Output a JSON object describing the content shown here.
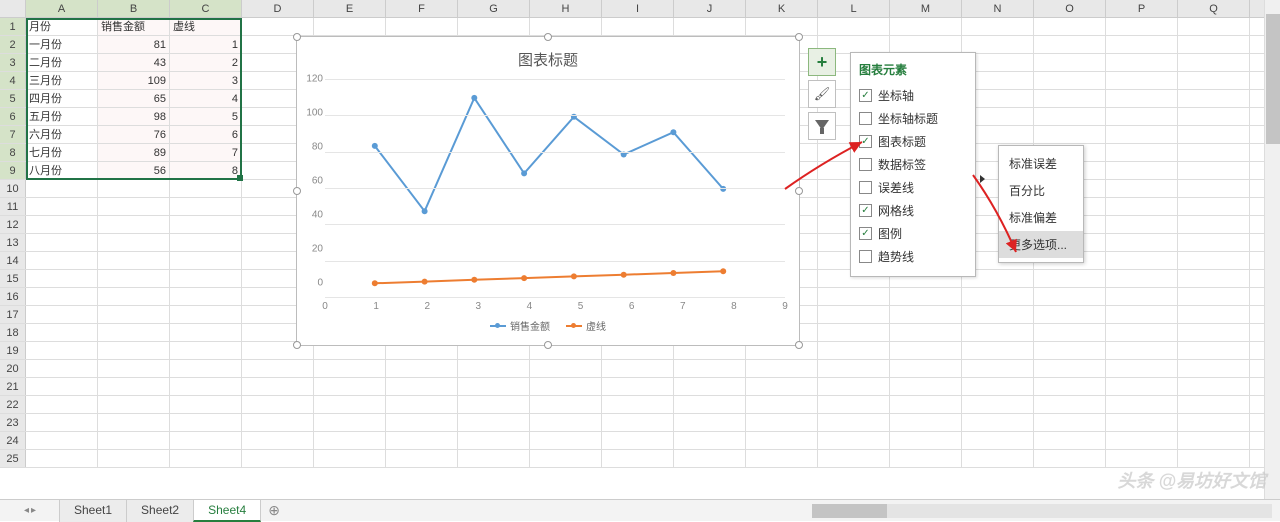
{
  "columns": [
    "A",
    "B",
    "C",
    "D",
    "E",
    "F",
    "G",
    "H",
    "I",
    "J",
    "K",
    "L",
    "M",
    "N",
    "O",
    "P",
    "Q"
  ],
  "rows": 25,
  "headers": {
    "A1": "月份",
    "B1": "销售金额",
    "C1": "虚线"
  },
  "table": [
    {
      "month": "一月份",
      "sales": 81,
      "dash": 1
    },
    {
      "month": "二月份",
      "sales": 43,
      "dash": 2
    },
    {
      "month": "三月份",
      "sales": 109,
      "dash": 3
    },
    {
      "month": "四月份",
      "sales": 65,
      "dash": 4
    },
    {
      "month": "五月份",
      "sales": 98,
      "dash": 5
    },
    {
      "month": "六月份",
      "sales": 76,
      "dash": 6
    },
    {
      "month": "七月份",
      "sales": 89,
      "dash": 7
    },
    {
      "month": "八月份",
      "sales": 56,
      "dash": 8
    }
  ],
  "chart_data": {
    "type": "line",
    "title": "图表标题",
    "x": [
      1,
      2,
      3,
      4,
      5,
      6,
      7,
      8
    ],
    "x_ticks": [
      0,
      1,
      2,
      3,
      4,
      5,
      6,
      7,
      8,
      9
    ],
    "y_ticks": [
      0,
      20,
      40,
      60,
      80,
      100,
      120
    ],
    "ylim": [
      0,
      120
    ],
    "xlim": [
      0,
      9
    ],
    "series": [
      {
        "name": "销售金额",
        "values": [
          81,
          43,
          109,
          65,
          98,
          76,
          89,
          56
        ],
        "color": "#5a9bd5"
      },
      {
        "name": "虚线",
        "values": [
          1,
          2,
          3,
          4,
          5,
          6,
          7,
          8
        ],
        "color": "#ed7d31"
      }
    ]
  },
  "chart_btns": {
    "add": "+",
    "style": "brush",
    "filter": "funnel"
  },
  "panel": {
    "title": "图表元素",
    "items": [
      {
        "label": "坐标轴",
        "checked": true
      },
      {
        "label": "坐标轴标题",
        "checked": false
      },
      {
        "label": "图表标题",
        "checked": true
      },
      {
        "label": "数据标签",
        "checked": false
      },
      {
        "label": "误差线",
        "checked": false
      },
      {
        "label": "网格线",
        "checked": true
      },
      {
        "label": "图例",
        "checked": true
      },
      {
        "label": "趋势线",
        "checked": false
      }
    ]
  },
  "submenu": {
    "items": [
      "标准误差",
      "百分比",
      "标准偏差",
      "更多选项..."
    ],
    "hover_index": 3
  },
  "tabs": {
    "list": [
      "Sheet1",
      "Sheet2",
      "Sheet4"
    ],
    "active": 2,
    "new": "⊕"
  },
  "watermark": "头条 @易坊好文馆"
}
